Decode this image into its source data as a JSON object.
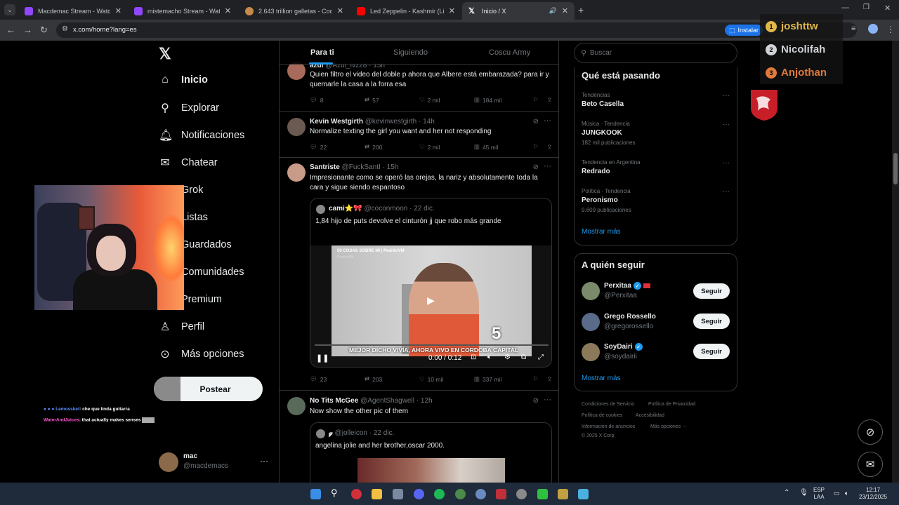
{
  "browser": {
    "tabs": [
      {
        "title": "Macdemac Stream - Watch Live",
        "favicon_color": "#9146ff",
        "active": false
      },
      {
        "title": "mistemacho Stream - Watch Live",
        "favicon_color": "#9146ff",
        "active": false
      },
      {
        "title": "2.643 trillion galletas - Cookie C",
        "favicon_color": "#c58a4a",
        "active": false
      },
      {
        "title": "Led Zeppelin - Kashmir (Live fro",
        "favicon_color": "#ff0000",
        "active": false
      },
      {
        "title": "Inicio / X",
        "favicon_color": "#ffffff",
        "active": true
      }
    ],
    "url": "x.com/home?lang=es",
    "install_label": "Instalar"
  },
  "nav": {
    "items": [
      {
        "label": "Inicio",
        "icon": "home-icon"
      },
      {
        "label": "Explorar",
        "icon": "search-icon"
      },
      {
        "label": "Notificaciones",
        "icon": "bell-icon"
      },
      {
        "label": "Chatear",
        "icon": "mail-icon"
      },
      {
        "label": "Grok",
        "icon": "grok-icon"
      },
      {
        "label": "Listas",
        "icon": "list-icon"
      },
      {
        "label": "Guardados",
        "icon": "bookmark-icon"
      },
      {
        "label": "Comunidades",
        "icon": "community-icon"
      },
      {
        "label": "Premium",
        "icon": "x-icon"
      },
      {
        "label": "Perfil",
        "icon": "user-icon"
      },
      {
        "label": "Más opciones",
        "icon": "more-circle-icon"
      }
    ],
    "post_label": "Postear",
    "account": {
      "name": "mac",
      "handle": "@macdemacs"
    }
  },
  "chat": [
    {
      "user": "Lemossket",
      "text": ": che que linda guitarra",
      "color": "#5b8cff"
    },
    {
      "user": "WaterAndJuices",
      "text": ": that actually makes senses",
      "color": "#ff5ad2"
    }
  ],
  "timeline": {
    "tabs": [
      "Para ti",
      "Siguiendo",
      "Coscu Army"
    ],
    "tweets": [
      {
        "name": "azul",
        "handle": "@Azul_fvz28",
        "time": "15h",
        "text": "Quien filtro el video del doble p ahora que Albere está embarazada? para ir y quemarle la casa a la forra esa",
        "replies": "8",
        "reposts": "57",
        "likes": "2 mil",
        "views": "184 mil"
      },
      {
        "name": "Kevin Westgirth",
        "handle": "@kevinwestgirth",
        "time": "14h",
        "text": "Normalize texting the girl you want and her not responding",
        "replies": "22",
        "reposts": "200",
        "likes": "2 mil",
        "views": "45 mil"
      },
      {
        "name": "Santriste",
        "handle": "@FuckSantI",
        "time": "15h",
        "text": "Impresionante como se operó las orejas, la nariz y absolutamente toda la cara y sigue siendo espantoso",
        "quote": {
          "name": "cami⭐🎀",
          "handle": "@coconmoon",
          "time": "22 dic.",
          "text": "1,84 hijo de puts devolve el cinturón jj que robo más grande",
          "video": {
            "overlay_title": "50 COSAS SOBRE MI | PedritoVM",
            "overlay_channel": "PedritoVM",
            "caption": "MEJOR DICHO VIVÍA, AHORA VIVO EN CORDOBA CAPITAL",
            "number": "5",
            "time": "0:00 / 0:12",
            "progress": 0
          }
        },
        "replies": "23",
        "reposts": "203",
        "likes": "10 mil",
        "views": "337 mil"
      },
      {
        "name": "No Tits McGee",
        "handle": "@AgentShagwell",
        "time": "12h",
        "text": "Now show the other pic of them",
        "quote": {
          "name": "𝓰",
          "handle": "@jolleicon",
          "time": "22 dic.",
          "text": "angelina jolie and her brother,oscar 2000."
        }
      }
    ]
  },
  "sidebar": {
    "search_placeholder": "Buscar",
    "trends_title": "Qué está pasando",
    "trends": [
      {
        "context": "Tendencias",
        "name": "Beto Casella",
        "count": ""
      },
      {
        "context": "Música · Tendencia",
        "name": "JUNGKOOK",
        "count": "182 mil publicaciones"
      },
      {
        "context": "Tendencia en Argentina",
        "name": "Redrado",
        "count": ""
      },
      {
        "context": "Política · Tendencia",
        "name": "Peronismo",
        "count": "9.609 publicaciones"
      }
    ],
    "show_more": "Mostrar más",
    "follow_title": "A quién seguir",
    "follow": [
      {
        "name": "Perxitaa",
        "handle": "@Perxitaa",
        "button": "Seguir"
      },
      {
        "name": "Grego Rossello",
        "handle": "@gregorossello",
        "button": "Seguir"
      },
      {
        "name": "SoyDairi",
        "handle": "@soydairii",
        "button": "Seguir"
      }
    ],
    "footer": [
      "Condiciones de Servicio",
      "Política de Privacidad",
      "Política de cookies",
      "Accesibilidad",
      "Información de anuncios",
      "Más opciones ···",
      "© 2025 X Corp."
    ]
  },
  "leaderboard": [
    {
      "rank": "1",
      "name": "joshttw",
      "color": "#e0b84a"
    },
    {
      "rank": "2",
      "name": "Nicolifah",
      "color": "#cfd2d6"
    },
    {
      "rank": "3",
      "name": "Anjothan",
      "color": "#e07a3a"
    }
  ],
  "taskbar": {
    "lang": "ESP",
    "lang2": "LAA",
    "time": "12:17",
    "date": "23/12/2025"
  },
  "colors": {
    "accent": "#1d9bf0",
    "background": "#000000",
    "border": "#2f3336"
  }
}
